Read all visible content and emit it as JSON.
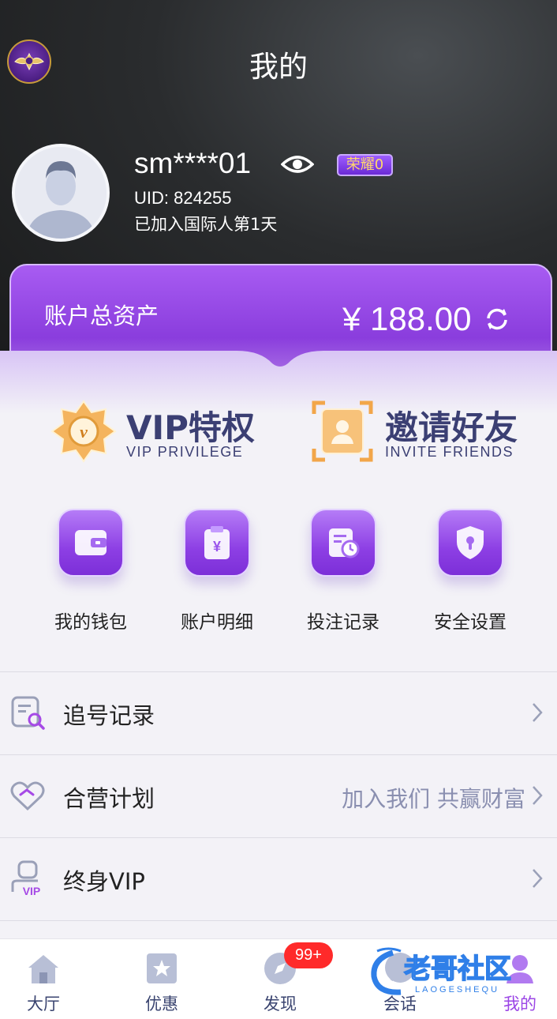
{
  "header": {
    "title": "我的"
  },
  "profile": {
    "username": "sm****01",
    "level_badge": "荣耀0",
    "uid": "UID: 824255",
    "joined": "已加入国际人第1天"
  },
  "assets": {
    "label": "账户总资产",
    "value": "¥ 188.00"
  },
  "promos": [
    {
      "title": "VIP特权",
      "subtitle": "VIP PRIVILEGE",
      "icon": "vip-badge-icon"
    },
    {
      "title": "邀请好友",
      "subtitle": "INVITE FRIENDS",
      "icon": "invite-friends-icon"
    }
  ],
  "quick_actions": [
    {
      "label": "我的钱包",
      "icon": "wallet-icon"
    },
    {
      "label": "账户明细",
      "icon": "account-detail-icon"
    },
    {
      "label": "投注记录",
      "icon": "bet-record-icon"
    },
    {
      "label": "安全设置",
      "icon": "security-shield-icon"
    }
  ],
  "menu": [
    {
      "label": "追号记录",
      "extra": "",
      "icon": "chase-record-icon"
    },
    {
      "label": "合营计划",
      "extra": "加入我们 共赢财富",
      "icon": "partnership-icon"
    },
    {
      "label": "终身VIP",
      "extra": "",
      "icon": "lifetime-vip-icon"
    }
  ],
  "tabbar": {
    "items": [
      {
        "label": "大厅",
        "icon": "home-icon"
      },
      {
        "label": "优惠",
        "icon": "promo-star-icon"
      },
      {
        "label": "发现",
        "icon": "discover-icon"
      },
      {
        "label": "会话",
        "icon": "chat-icon"
      },
      {
        "label": "我的",
        "icon": "profile-icon"
      }
    ],
    "discover_badge": "99+"
  },
  "watermark_text": "老哥社区",
  "watermark_sub": "LAOGESHEQU",
  "colors": {
    "accent": "#8d3fe4",
    "header_dark": "#1a1b1c",
    "tab_text": "#3a4470",
    "badge_red": "#ff2a2a"
  }
}
